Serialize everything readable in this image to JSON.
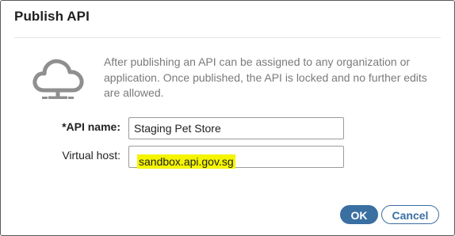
{
  "dialog": {
    "title": "Publish API",
    "message": "After publishing an API can be assigned to any organization or application. Once published, the API is locked and no further edits are allowed.",
    "icon": "cloud-network-icon"
  },
  "form": {
    "api_name_label": "*API name:",
    "api_name_value": "Staging Pet Store",
    "virtual_host_label": "Virtual host:",
    "virtual_host_value": "sandbox.api.gov.sg",
    "highlight_color": "#f5f500"
  },
  "buttons": {
    "ok_label": "OK",
    "cancel_label": "Cancel",
    "accent_color": "#3a6fa2"
  }
}
